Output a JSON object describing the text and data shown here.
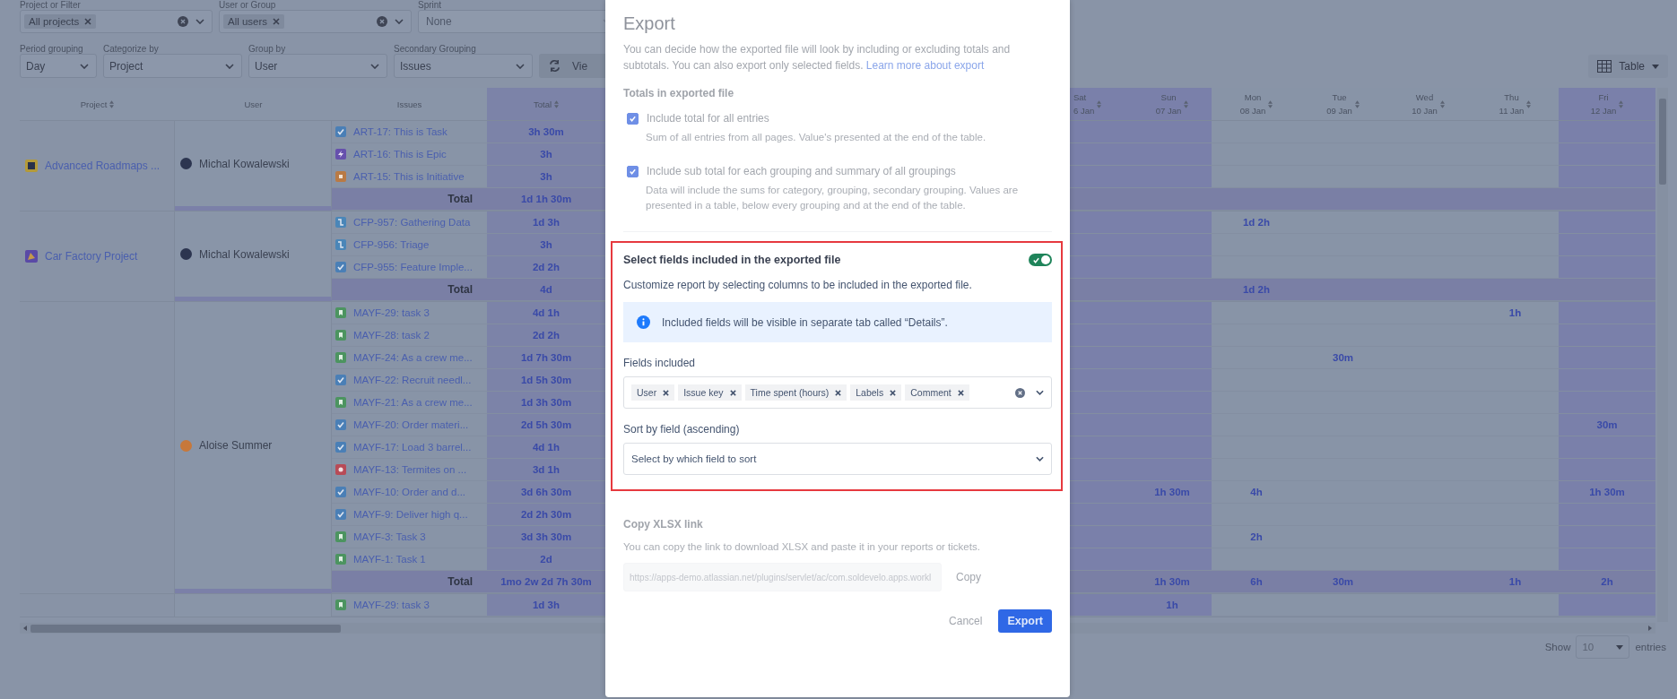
{
  "top_filters": [
    {
      "label": "Project or Filter",
      "chip": "All projects",
      "disabled": false
    },
    {
      "label": "User or Group",
      "chip": "All users",
      "disabled": false
    },
    {
      "label": "Sprint",
      "placeholder": "None",
      "disabled": true
    }
  ],
  "grouping_selects": [
    {
      "label": "Period grouping",
      "value": "Day"
    },
    {
      "label": "Categorize by",
      "value": "Project"
    },
    {
      "label": "Group by",
      "value": "User"
    },
    {
      "label": "Secondary Grouping",
      "value": "Issues"
    }
  ],
  "view_button": {
    "label": "Vie"
  },
  "view_switch": {
    "label": "Table"
  },
  "table": {
    "columns": [
      {
        "label": "Project",
        "sortable": true
      },
      {
        "label": "User",
        "sortable": false
      },
      {
        "label": "Issues",
        "sortable": false
      },
      {
        "label": "Total",
        "sortable": true
      }
    ],
    "day_columns": [
      {
        "day": "Sat",
        "date": "6 Jan",
        "highlighted": true
      },
      {
        "day": "Sun",
        "date": "07 Jan",
        "highlighted": true
      },
      {
        "day": "Mon",
        "date": "08 Jan",
        "highlighted": false
      },
      {
        "day": "Tue",
        "date": "09 Jan",
        "highlighted": false
      },
      {
        "day": "Wed",
        "date": "10 Jan",
        "highlighted": false
      },
      {
        "day": "Thu",
        "date": "11 Jan",
        "highlighted": false
      },
      {
        "day": "Fri",
        "date": "12 Jan",
        "highlighted": true
      }
    ],
    "groups": [
      {
        "project": {
          "name": "Advanced Roadmaps ..."
        },
        "user": {
          "name": "Michal Kowalewski",
          "color": "#2c3550"
        },
        "rows": [
          {
            "issue": "ART-17: This is Task",
            "kind": "task",
            "total": "3h 30m"
          },
          {
            "issue": "ART-16: This is Epic",
            "kind": "epic",
            "total": "3h"
          },
          {
            "issue": "ART-15: This is Initiative",
            "kind": "initiative",
            "total": "3h"
          }
        ],
        "subtotal": {
          "label": "Total",
          "total": "1d 1h 30m"
        }
      },
      {
        "project": {
          "name": "Car Factory Project"
        },
        "user": {
          "name": "Michal Kowalewski",
          "color": "#2c3550"
        },
        "rows": [
          {
            "issue": "CFP-957: Gathering Data",
            "kind": "subtask",
            "total": "1d 3h",
            "days": {
              "mon": "1d 2h"
            }
          },
          {
            "issue": "CFP-956: Triage",
            "kind": "subtask",
            "total": "3h"
          },
          {
            "issue": "CFP-955: Feature Imple...",
            "kind": "task",
            "total": "2d 2h"
          }
        ],
        "subtotal": {
          "label": "Total",
          "total": "4d",
          "days": {
            "mon": "1d 2h"
          }
        }
      },
      {
        "user": {
          "name": "Aloise Summer",
          "color": "#c7783a"
        },
        "rows": [
          {
            "issue": "MAYF-29: task 3",
            "kind": "story",
            "total": "4d 1h",
            "days": {
              "thu": "1h"
            }
          },
          {
            "issue": "MAYF-28: task 2",
            "kind": "story",
            "total": "2d 2h"
          },
          {
            "issue": "MAYF-24: As a crew me...",
            "kind": "story",
            "total": "1d 7h 30m",
            "days": {
              "tue": "30m"
            }
          },
          {
            "issue": "MAYF-22: Recruit needl...",
            "kind": "task",
            "total": "1d 5h 30m"
          },
          {
            "issue": "MAYF-21: As a crew me...",
            "kind": "story",
            "total": "1d 3h 30m"
          },
          {
            "issue": "MAYF-20: Order materi...",
            "kind": "task",
            "total": "2d 5h 30m",
            "days": {
              "fri": "30m"
            }
          },
          {
            "issue": "MAYF-17: Load 3 barrel...",
            "kind": "task",
            "total": "4d 1h"
          },
          {
            "issue": "MAYF-13: Termites on ...",
            "kind": "bug",
            "total": "3d 1h"
          },
          {
            "issue": "MAYF-10: Order and d...",
            "kind": "task",
            "total": "3d 6h 30m",
            "days": {
              "sun": "1h 30m",
              "mon": "4h",
              "fri": "1h 30m"
            }
          },
          {
            "issue": "MAYF-9: Deliver high q...",
            "kind": "task",
            "total": "2d 2h 30m"
          },
          {
            "issue": "MAYF-3: Task 3",
            "kind": "story",
            "total": "3d 3h 30m",
            "days": {
              "mon": "2h"
            }
          },
          {
            "issue": "MAYF-1: Task 1",
            "kind": "story",
            "total": "2d"
          }
        ],
        "subtotal": {
          "label": "Total",
          "total": "1mo 2w 2d 7h 30m",
          "days": {
            "sun": "1h 30m",
            "mon": "6h",
            "tue": "30m",
            "thu": "1h",
            "fri": "2h"
          }
        }
      },
      {
        "rows": [
          {
            "issue": "MAYF-29: task 3",
            "kind": "story",
            "total": "1d 3h",
            "days": {
              "sun": "1h"
            }
          }
        ]
      }
    ]
  },
  "pagination": {
    "show_label": "Show",
    "page_size": "10",
    "entries_label": "entries"
  },
  "export_dialog": {
    "title": "Export",
    "intro": "You can decide how the exported file will look by including or excluding totals and subtotals. You can also export only selected fields.",
    "intro_link": "Learn more about export",
    "totals_heading": "Totals in exported file",
    "options": [
      {
        "label": "Include total for all entries",
        "description": "Sum of all entries from all pages. Value's presented at the end of the table.",
        "checked": true
      },
      {
        "label": "Include sub total for each grouping and summary of all groupings",
        "description": "Data will include the sums for category, grouping, secondary grouping. Values are presented in a table, below every grouping and at the end of the table.",
        "checked": true
      }
    ],
    "fields_section": {
      "title": "Select fields included in the exported file",
      "enabled": true,
      "description": "Customize report by selecting columns to be included in the exported file.",
      "info": "Included fields will be visible in separate tab called “Details”.",
      "fields_label": "Fields included",
      "fields": [
        "User",
        "Issue key",
        "Time spent (hours)",
        "Labels",
        "Comment"
      ],
      "sort_label": "Sort by field (ascending)",
      "sort_placeholder": "Select by which field to sort"
    },
    "copy_section": {
      "title": "Copy XLSX link",
      "description": "You can copy the link to download XLSX and paste it in your reports or tickets.",
      "url": "https://apps-demo.atlassian.net/plugins/servlet/ac/com.soldevelo.apps.workl",
      "copy_button": "Copy"
    },
    "buttons": {
      "cancel": "Cancel",
      "export": "Export"
    }
  }
}
